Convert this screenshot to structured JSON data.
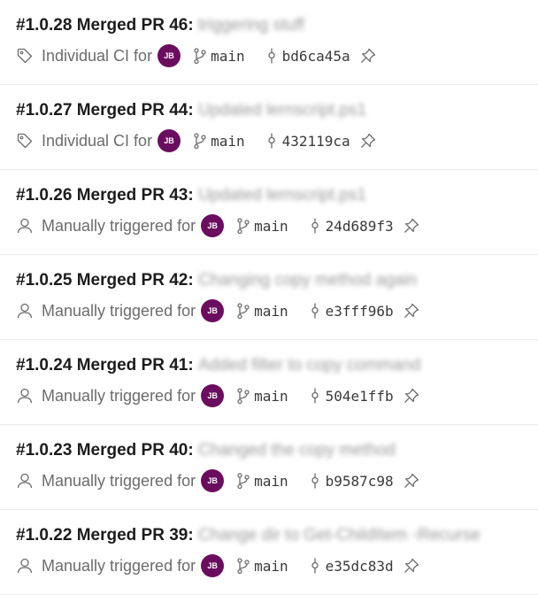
{
  "runs": [
    {
      "id": "#1.0.28",
      "pr": "Merged PR 46:",
      "desc": "triggering stuff",
      "reason": "Individual CI for",
      "trigger": "tag",
      "initials": "JB",
      "branch": "main",
      "commit": "bd6ca45a"
    },
    {
      "id": "#1.0.27",
      "pr": "Merged PR 44:",
      "desc": "Updated lernscript.ps1",
      "reason": "Individual CI for",
      "trigger": "tag",
      "initials": "JB",
      "branch": "main",
      "commit": "432119ca"
    },
    {
      "id": "#1.0.26",
      "pr": "Merged PR 43:",
      "desc": "Updated lernscript.ps1",
      "reason": "Manually triggered for",
      "trigger": "person",
      "initials": "JB",
      "branch": "main",
      "commit": "24d689f3"
    },
    {
      "id": "#1.0.25",
      "pr": "Merged PR 42:",
      "desc": "Changing copy method again",
      "reason": "Manually triggered for",
      "trigger": "person",
      "initials": "JB",
      "branch": "main",
      "commit": "e3fff96b"
    },
    {
      "id": "#1.0.24",
      "pr": "Merged PR 41:",
      "desc": "Added filter to copy command",
      "reason": "Manually triggered for",
      "trigger": "person",
      "initials": "JB",
      "branch": "main",
      "commit": "504e1ffb"
    },
    {
      "id": "#1.0.23",
      "pr": "Merged PR 40:",
      "desc": "Changed the copy method",
      "reason": "Manually triggered for",
      "trigger": "person",
      "initials": "JB",
      "branch": "main",
      "commit": "b9587c98"
    },
    {
      "id": "#1.0.22",
      "pr": "Merged PR 39:",
      "desc": "Change dir to Get-ChildItem -Recurse",
      "reason": "Manually triggered for",
      "trigger": "person",
      "initials": "JB",
      "branch": "main",
      "commit": "e35dc83d"
    }
  ],
  "icons": {
    "tag": "tag-icon",
    "person": "person-icon",
    "branch": "branch-icon",
    "commit": "commit-icon",
    "pin": "pin-icon"
  },
  "colors": {
    "avatar": "#6b0d5f",
    "title": "#1c1c1c",
    "meta": "#6c6c6c"
  }
}
